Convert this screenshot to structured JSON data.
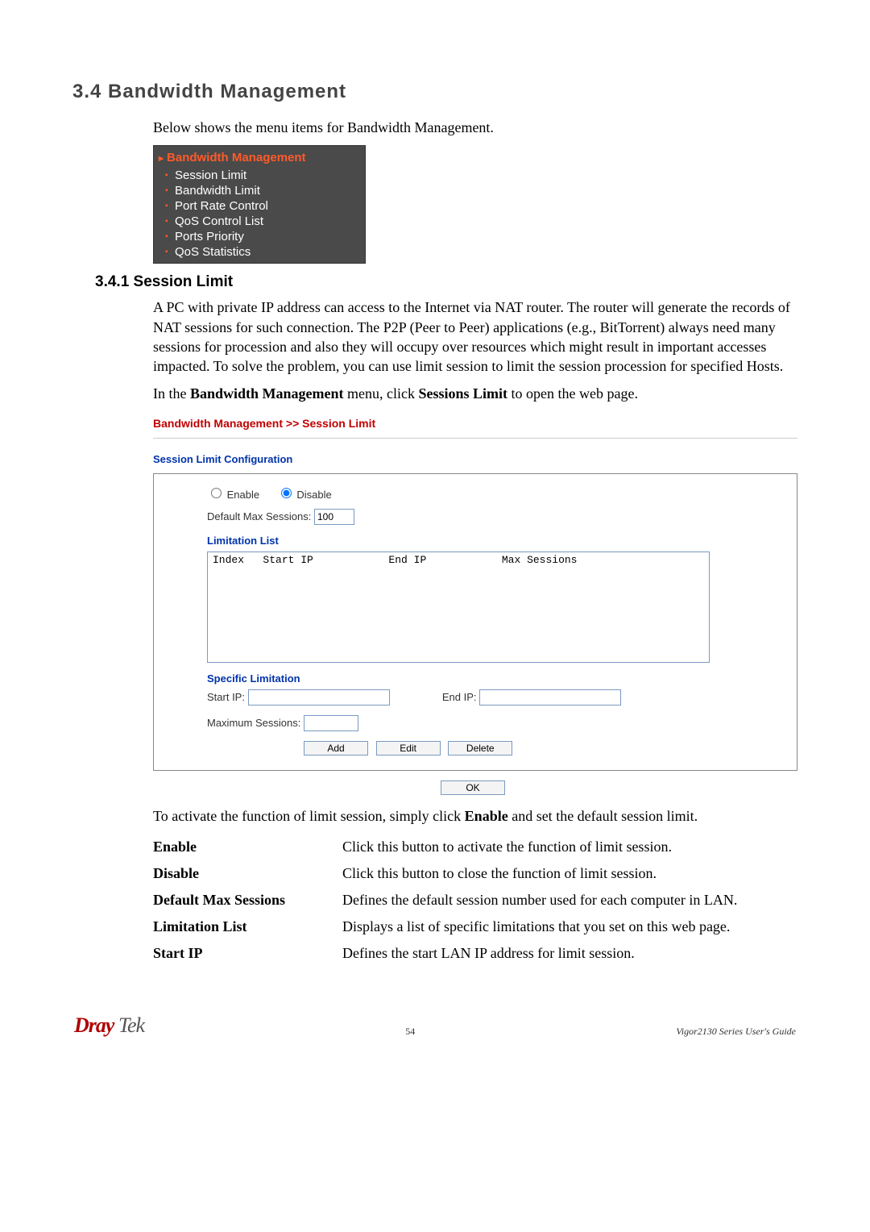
{
  "section": {
    "number_title": "3.4 Bandwidth Management",
    "intro": "Below shows the menu items for Bandwidth Management."
  },
  "menu": {
    "title": "Bandwidth Management",
    "items": [
      "Session Limit",
      "Bandwidth Limit",
      "Port Rate Control",
      "QoS Control List",
      "Ports Priority",
      "QoS Statistics"
    ]
  },
  "subsection": {
    "title": "3.4.1 Session Limit",
    "paragraph": "A PC with private IP address can access to the Internet via NAT router. The router will generate the records of NAT sessions for such connection. The P2P (Peer to Peer) applications (e.g., BitTorrent) always need many sessions for procession and also they will occupy over resources which might result in important accesses impacted. To solve the problem, you can use limit session to limit the session procession for specified Hosts.",
    "instruction_pre": "In the ",
    "instruction_bold1": "Bandwidth Management",
    "instruction_mid": " menu, click ",
    "instruction_bold2": "Sessions Limit",
    "instruction_post": " to open the web page."
  },
  "config": {
    "breadcrumb": "Bandwidth Management >> Session Limit",
    "subtitle": "Session Limit Configuration",
    "enable_label": "Enable",
    "disable_label": "Disable",
    "default_max_label": "Default Max Sessions:",
    "default_max_value": "100",
    "limitation_list_heading": "Limitation List",
    "list_header": "Index   Start IP            End IP            Max Sessions",
    "specific_heading": "Specific Limitation",
    "start_ip_label": "Start IP:",
    "end_ip_label": "End IP:",
    "max_sessions_label": "Maximum Sessions:",
    "buttons": {
      "add": "Add",
      "edit": "Edit",
      "delete": "Delete",
      "ok": "OK"
    }
  },
  "activate_text_pre": "To activate the function of limit session, simply click ",
  "activate_text_bold": "Enable",
  "activate_text_post": " and set the default session limit.",
  "definitions": [
    {
      "term": "Enable",
      "desc": "Click this button to activate the function of limit session."
    },
    {
      "term": "Disable",
      "desc": "Click this button to close the function of limit session."
    },
    {
      "term": "Default Max Sessions",
      "desc": "Defines the default session number used for each computer in LAN."
    },
    {
      "term": "Limitation List",
      "desc": "Displays a list of specific limitations that you set on this web page."
    },
    {
      "term": "Start IP",
      "desc": "Defines the start LAN IP address for limit session."
    }
  ],
  "footer": {
    "logo_dray": "Dray",
    "logo_tek": " Tek",
    "page_number": "54",
    "guide": "Vigor2130  Series  User's  Guide"
  }
}
